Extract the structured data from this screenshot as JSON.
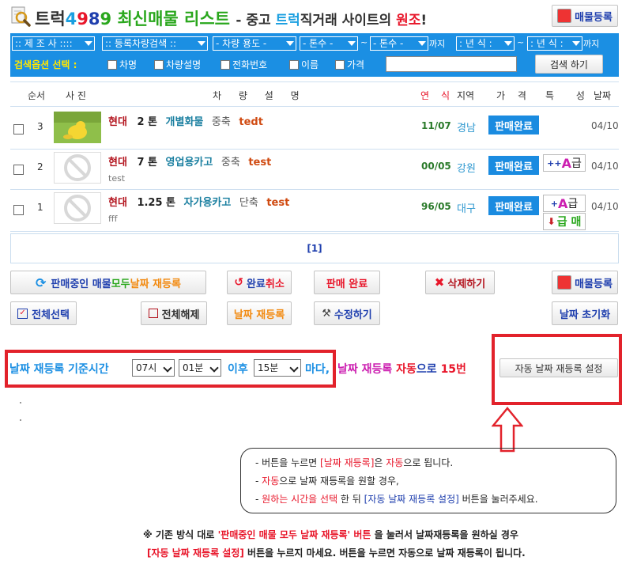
{
  "header": {
    "title_part1": "트럭",
    "title_4": "4",
    "title_9a": "9",
    "title_8": "8",
    "title_9b": "9",
    "title_part2": " 최신매물 리스트",
    "dash": " - ",
    "sub1": "중고 ",
    "sub2": "트럭",
    "sub3": "직거래 사이트의 ",
    "sub4": "원조",
    "sub5": "!",
    "register_label": "매물등록"
  },
  "search": {
    "maker": ":: 제 조 사 :::: ",
    "reg_type": ":: 등록차량검색 :: ",
    "usage": "- 차량 용도 -",
    "ton_from": "- 톤수 -",
    "ton_to": "- 톤수 -",
    "ton_suffix": "까지",
    "year_from": ": 년 식 :",
    "year_to": ": 년 식 :",
    "year_suffix": "까지",
    "tilde": "~",
    "option_label": "검색옵션 선택 :",
    "options": [
      "차명",
      "차량설명",
      "전화번호",
      "이름",
      "가격"
    ],
    "button": "검색 하기"
  },
  "table": {
    "headers": {
      "order": "순서",
      "photo": "사 진",
      "desc": "차 량 설 명",
      "year1": "연",
      "year2": "식",
      "region": "지역",
      "price": "가 격",
      "feature": "특 성",
      "date": "날짜"
    },
    "rows": [
      {
        "num": "3",
        "brand": "현대",
        "ton": "2 톤",
        "type": "개별화물",
        "shaft": "중축",
        "title": "tedt",
        "note": "",
        "year": "11/07",
        "region": "경남",
        "status": "판매완료",
        "date": "04/10"
      },
      {
        "num": "2",
        "brand": "현대",
        "ton": "7 톤",
        "type": "영업용카고",
        "shaft": "중축",
        "title": "test",
        "note": "test",
        "year": "00/05",
        "region": "강원",
        "status": "판매완료",
        "date": "04/10"
      },
      {
        "num": "1",
        "brand": "현대",
        "ton": "1.25 톤",
        "type": "자가용카고",
        "shaft": "단축",
        "title": "test",
        "note": "fff",
        "year": "96/05",
        "region": "대구",
        "status": "판매완료",
        "date": "04/10"
      }
    ],
    "badge_plus2": "++",
    "badge_plus1": "+",
    "badge_a": "A",
    "badge_geup": "급",
    "badge_geupmae": "급 매"
  },
  "pager": "[1]",
  "actions": {
    "redate_all_1": "판매중인 매물 ",
    "redate_all_2": "모두 ",
    "redate_all_3": "날짜 재등록",
    "cancel_1": "완료",
    "cancel_2": "취소",
    "sold_done": "판매 완료",
    "delete": "삭제하기",
    "register": "매물등록",
    "select_all": "전체선택",
    "deselect_all": "전체해제",
    "redate": "날짜 재등록",
    "edit": "수정하기",
    "reset_date": "날짜 초기화"
  },
  "schedule": {
    "label": "날짜 재등록 기준시간",
    "hour": "07시",
    "minute": "01분",
    "after": "이후",
    "interval": "15분",
    "every": "마다,",
    "r1": "날짜 재등록 ",
    "r2": "자동",
    "r3": "으로 ",
    "r4": "15번",
    "auto_button": "자동 날짜 재등록 설정"
  },
  "info": {
    "l1a": "- 버튼을 누르면 ",
    "l1b": "[날짜 재등록]",
    "l1c": "은 ",
    "l1d": "자동",
    "l1e": "으로 됩니다.",
    "l2a": "- ",
    "l2b": "자동",
    "l2c": "으로 날짜 재등록을 원할 경우,",
    "l3a": "- ",
    "l3b": "원하는 시간을 선택",
    "l3c": " 한 뒤 ",
    "l3d": "[자동 날짜 재등록 설정]",
    "l3e": " 버튼을 눌러주세요."
  },
  "note": {
    "n1a": "※ 기존 방식 대로 ",
    "n1b": "'판매중인 매물 모두 날짜 재등록'",
    "n1c": " 버튼 ",
    "n1d": "을 눌러서 날짜재등록을 원하실 경우",
    "n2a": "[자동 날짜 재등록 설정]",
    "n2b": " 버튼을 누르지 마세요. 버튼을 누르면 자동으로 날짜 재등록이 됩니다."
  }
}
